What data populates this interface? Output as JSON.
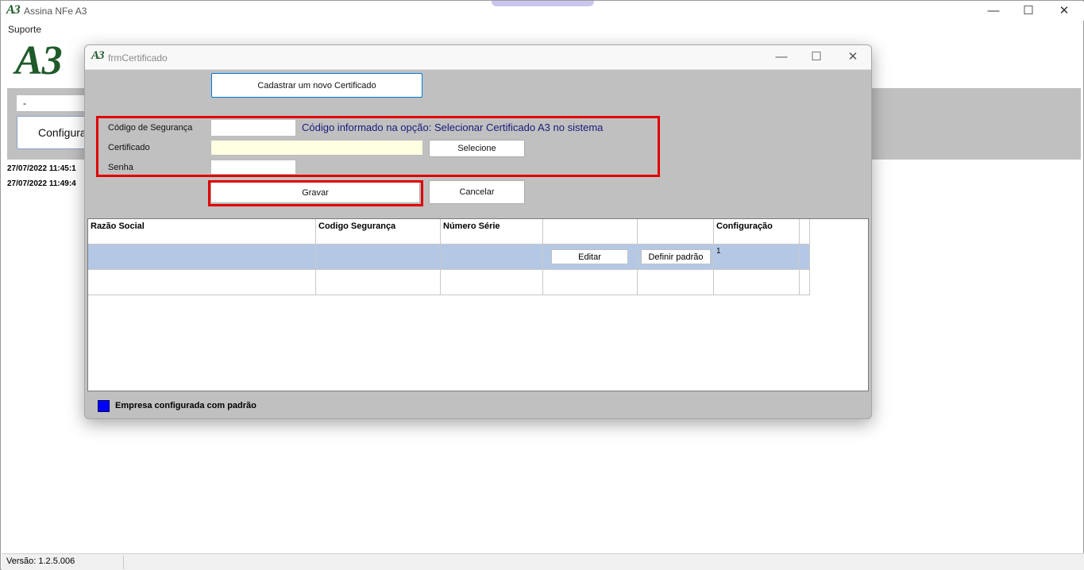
{
  "main_window": {
    "title": "Assina NFe A3",
    "logo_small": "A3",
    "logo_large": "A3",
    "menu": [
      "Suporte"
    ],
    "combo_value": "-",
    "config_button_label": "Configura",
    "log_entries": [
      "27/07/2022 11:45:1",
      "27/07/2022 11:49:4"
    ],
    "status_version": "Versão: 1.2.5.006",
    "controls": {
      "minimize": "—",
      "maximize": "☐",
      "close": "✕"
    }
  },
  "dialog": {
    "title": "frmCertificado",
    "logo": "A3",
    "controls": {
      "minimize": "—",
      "maximize": "☐",
      "close": "✕"
    },
    "new_cert_button": "Cadastrar um novo Certificado",
    "form": {
      "security_code_label": "Código de Segurança",
      "security_code_value": "",
      "security_code_hint": "Código informado na opção: Selecionar Certificado A3 no sistema",
      "certificate_label": "Certificado",
      "certificate_value": "",
      "select_button": "Selecione",
      "password_label": "Senha",
      "password_value": ""
    },
    "save_button": "Gravar",
    "cancel_button": "Cancelar",
    "grid": {
      "headers": [
        "Razão Social",
        "Codigo Segurança",
        "Número Série",
        "",
        "",
        "Configuração"
      ],
      "rows": [
        {
          "razao": "",
          "codigo": "",
          "serie": "",
          "edit_label": "Editar",
          "default_label": "Definir padrão",
          "config": "1"
        }
      ]
    },
    "legend": {
      "text": "Empresa configurada com padrão",
      "color": "#0000ff"
    }
  },
  "colors": {
    "highlight_red": "#e00000",
    "logo_green": "#1f5a2a",
    "selected_row": "#b4c8e6",
    "hint_text": "#1a1a7a"
  }
}
